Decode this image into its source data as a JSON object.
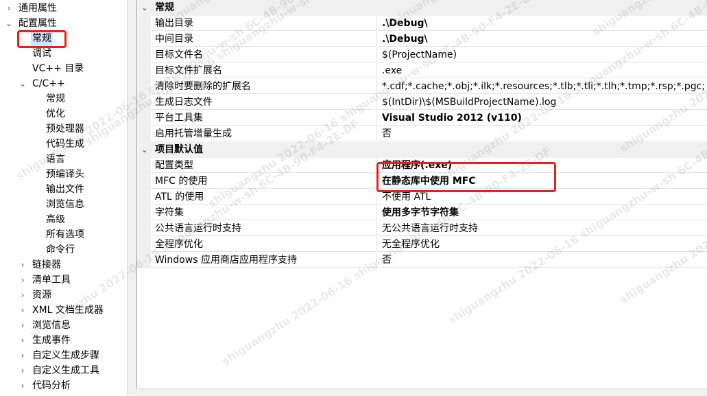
{
  "tree": {
    "items": [
      {
        "label": "通用属性",
        "expander": "›"
      },
      {
        "label": "配置属性",
        "expander": "⌄"
      },
      {
        "label": "常规",
        "expander": ""
      },
      {
        "label": "调试",
        "expander": ""
      },
      {
        "label": "VC++ 目录",
        "expander": ""
      },
      {
        "label": "C/C++",
        "expander": "⌄"
      },
      {
        "label": "常规",
        "expander": ""
      },
      {
        "label": "优化",
        "expander": ""
      },
      {
        "label": "预处理器",
        "expander": ""
      },
      {
        "label": "代码生成",
        "expander": ""
      },
      {
        "label": "语言",
        "expander": ""
      },
      {
        "label": "预编译头",
        "expander": ""
      },
      {
        "label": "输出文件",
        "expander": ""
      },
      {
        "label": "浏览信息",
        "expander": ""
      },
      {
        "label": "高级",
        "expander": ""
      },
      {
        "label": "所有选项",
        "expander": ""
      },
      {
        "label": "命令行",
        "expander": ""
      },
      {
        "label": "链接器",
        "expander": "›"
      },
      {
        "label": "清单工具",
        "expander": "›"
      },
      {
        "label": "资源",
        "expander": "›"
      },
      {
        "label": "XML 文档生成器",
        "expander": "›"
      },
      {
        "label": "浏览信息",
        "expander": "›"
      },
      {
        "label": "生成事件",
        "expander": "›"
      },
      {
        "label": "自定义生成步骤",
        "expander": "›"
      },
      {
        "label": "自定义生成工具",
        "expander": "›"
      },
      {
        "label": "代码分析",
        "expander": "›"
      }
    ],
    "selected_index": 2
  },
  "grid": {
    "categories": [
      {
        "label": "常规",
        "expander": "⌄",
        "rows": [
          {
            "name": "输出目录",
            "value": ".\\Debug\\",
            "bold": true
          },
          {
            "name": "中间目录",
            "value": ".\\Debug\\",
            "bold": true
          },
          {
            "name": "目标文件名",
            "value": "$(ProjectName)",
            "bold": false
          },
          {
            "name": "目标文件扩展名",
            "value": ".exe",
            "bold": false
          },
          {
            "name": "清除时要删除的扩展名",
            "value": "*.cdf;*.cache;*.obj;*.ilk;*.resources;*.tlb;*.tli;*.tlh;*.tmp;*.rsp;*.pgc;",
            "bold": false
          },
          {
            "name": "生成日志文件",
            "value": "$(IntDir)\\$(MSBuildProjectName).log",
            "bold": false
          },
          {
            "name": "平台工具集",
            "value": "Visual Studio 2012 (v110)",
            "bold": true
          },
          {
            "name": "启用托管增量生成",
            "value": "否",
            "bold": false
          }
        ]
      },
      {
        "label": "项目默认值",
        "expander": "⌄",
        "rows": [
          {
            "name": "配置类型",
            "value": "应用程序(.exe)",
            "bold": true
          },
          {
            "name": "MFC 的使用",
            "value": "在静态库中使用 MFC",
            "bold": true
          },
          {
            "name": "ATL 的使用",
            "value": "不使用 ATL",
            "bold": false
          },
          {
            "name": "字符集",
            "value": "使用多字节字符集",
            "bold": true
          },
          {
            "name": "公共语言运行时支持",
            "value": "无公共语言运行时支持",
            "bold": false
          },
          {
            "name": "全程序优化",
            "value": "无全程序优化",
            "bold": false
          },
          {
            "name": "Windows 应用商店应用程序支持",
            "value": "否",
            "bold": false
          }
        ]
      }
    ]
  },
  "watermark": {
    "text": "shiguangzhu  2022-06-16  shiguangzhu-w-sh  6C-4B-90-F4-2E-DF"
  },
  "colors": {
    "highlight": "#e8201c",
    "selection": "#cce8ff",
    "category_bg": "#f0f0f0"
  }
}
